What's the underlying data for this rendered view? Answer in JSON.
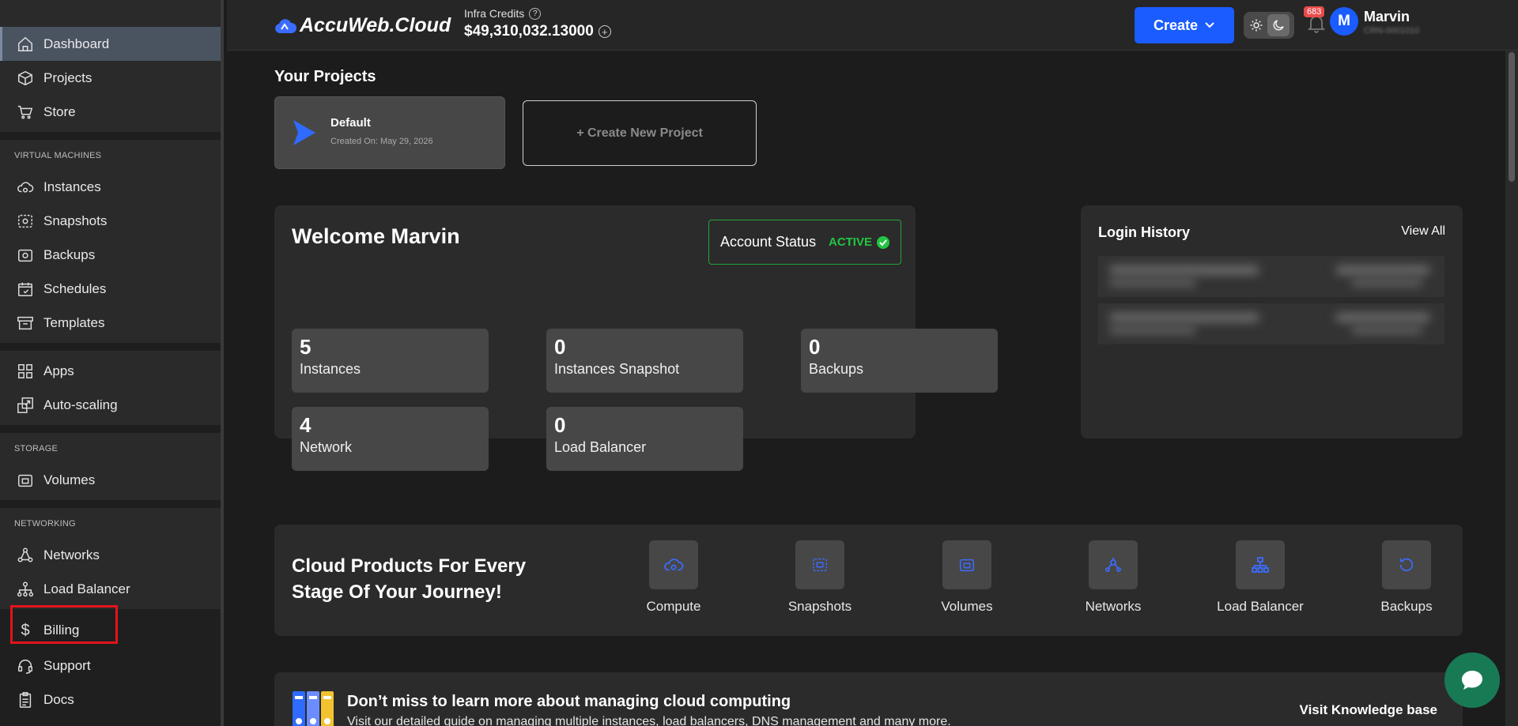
{
  "sidebar": {
    "items_top": [
      {
        "label": "Dashboard",
        "icon": "home-icon",
        "active": true
      },
      {
        "label": "Projects",
        "icon": "cube-icon"
      },
      {
        "label": "Store",
        "icon": "cart-icon"
      }
    ],
    "sections": [
      {
        "title": "VIRTUAL MACHINES",
        "items": [
          {
            "label": "Instances",
            "icon": "cloud-gear-icon"
          },
          {
            "label": "Snapshots",
            "icon": "snapshot-icon"
          },
          {
            "label": "Backups",
            "icon": "backup-icon"
          },
          {
            "label": "Schedules",
            "icon": "calendar-icon"
          },
          {
            "label": "Templates",
            "icon": "archive-icon"
          }
        ]
      },
      {
        "title": "",
        "items": [
          {
            "label": "Apps",
            "icon": "apps-grid-icon"
          },
          {
            "label": "Auto-scaling",
            "icon": "autoscale-icon"
          }
        ]
      },
      {
        "title": "STORAGE",
        "items": [
          {
            "label": "Volumes",
            "icon": "volume-icon"
          }
        ]
      },
      {
        "title": "NETWORKING",
        "items": [
          {
            "label": "Networks",
            "icon": "network-icon"
          },
          {
            "label": "Load Balancer",
            "icon": "load-balancer-icon"
          }
        ]
      }
    ],
    "items_bottom": [
      {
        "label": "Billing",
        "icon": "dollar-icon"
      },
      {
        "label": "Support",
        "icon": "headset-icon"
      },
      {
        "label": "Docs",
        "icon": "clipboard-icon"
      }
    ]
  },
  "header": {
    "logo_text": "AccuWeb.Cloud",
    "credits_label": "Infra Credits",
    "credits_help": "?",
    "credits_value": "$49,310,032.13000",
    "create_label": "Create",
    "notification_count": "683",
    "avatar_initial": "M",
    "user_name": "Marvin",
    "user_sub": "CRN-0001010"
  },
  "projects": {
    "title": "Your Projects",
    "default": {
      "name": "Default",
      "created": "Created On: May 29, 2026"
    },
    "new_label": "+ Create New Project"
  },
  "welcome": {
    "title": "Welcome Marvin",
    "status_label": "Account Status",
    "status_value": "ACTIVE",
    "stats": [
      {
        "num": "5",
        "label": "Instances"
      },
      {
        "num": "0",
        "label": "Instances Snapshot"
      },
      {
        "num": "0",
        "label": "Backups"
      },
      {
        "num": "4",
        "label": "Network"
      },
      {
        "num": "0",
        "label": "Load Balancer"
      }
    ]
  },
  "login_history": {
    "title": "Login History",
    "view_all": "View All"
  },
  "products": {
    "tagline": "Cloud Products For Every Stage Of Your Journey!",
    "items": [
      {
        "label": "Compute",
        "icon": "compute-icon"
      },
      {
        "label": "Snapshots",
        "icon": "snapshot-icon"
      },
      {
        "label": "Volumes",
        "icon": "volume-icon"
      },
      {
        "label": "Networks",
        "icon": "network-icon"
      },
      {
        "label": "Load Balancer",
        "icon": "load-balancer-icon"
      },
      {
        "label": "Backups",
        "icon": "backup-icon"
      }
    ]
  },
  "kb": {
    "title": "Don’t miss to learn more about managing cloud computing",
    "text": "Visit our detailed guide on managing multiple instances, load balancers, DNS management and many more.",
    "link": "Visit Knowledge base"
  },
  "colors": {
    "accent": "#1a5cff",
    "active_status": "#22c543",
    "highlight_box": "#e1141b",
    "chat": "#187a55"
  }
}
